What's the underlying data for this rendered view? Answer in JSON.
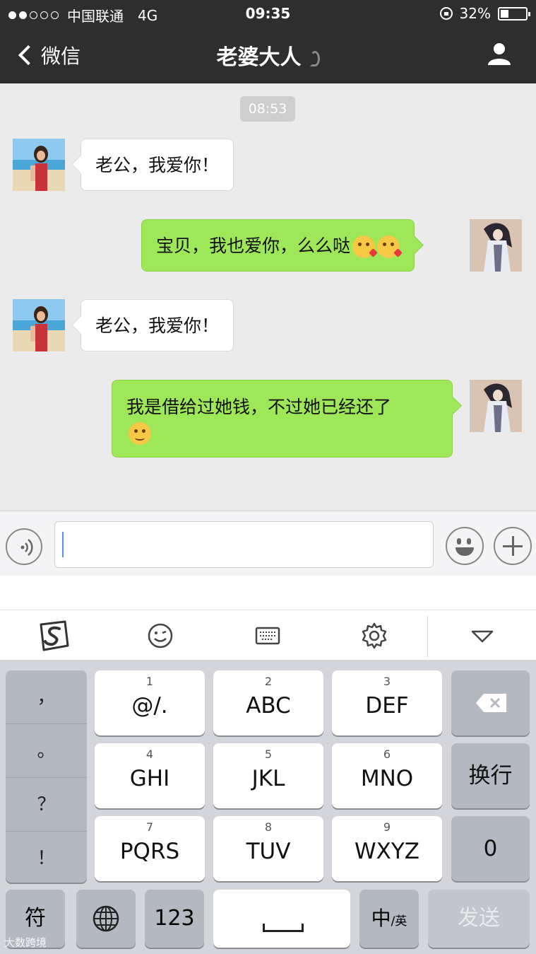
{
  "status_bar": {
    "carrier": "中国联通",
    "network": "4G",
    "time": "09:35",
    "battery_percent_text": "32%",
    "battery_level": 0.32,
    "signal_dots_filled": 2,
    "signal_dots_total": 5
  },
  "nav": {
    "back_label": "微信",
    "title": "老婆大人"
  },
  "chat": {
    "timestamp": "08:53",
    "messages": [
      {
        "side": "left",
        "text": "老公，我爱你！"
      },
      {
        "side": "right",
        "text": "宝贝，我也爱你，么么哒",
        "emojis": [
          "kiss-emoji",
          "kiss-emoji"
        ]
      },
      {
        "side": "left",
        "text": "老公，我爱你！"
      },
      {
        "side": "right",
        "text_line1": "我是借给过她钱，不过她已经还了",
        "emojis": [
          "blush-emoji"
        ]
      }
    ]
  },
  "input": {
    "value": "",
    "placeholder": ""
  },
  "ime_toolbar": {
    "items": [
      "sogou-logo-icon",
      "emoji-icon",
      "keyboard-icon",
      "settings-icon",
      "collapse-icon"
    ]
  },
  "keyboard": {
    "punctuation": [
      "，",
      "。",
      "？",
      "！"
    ],
    "keys": [
      {
        "num": "1",
        "label": "@/."
      },
      {
        "num": "2",
        "label": "ABC"
      },
      {
        "num": "3",
        "label": "DEF"
      },
      {
        "num": "4",
        "label": "GHI"
      },
      {
        "num": "5",
        "label": "JKL"
      },
      {
        "num": "6",
        "label": "MNO"
      },
      {
        "num": "7",
        "label": "PQRS"
      },
      {
        "num": "8",
        "label": "TUV"
      },
      {
        "num": "9",
        "label": "WXYZ"
      }
    ],
    "newline_label": "换行",
    "zero_label": "0",
    "symbol_label": "符",
    "numbers_label": "123",
    "lang_main": "中",
    "lang_sub": "/英",
    "send_label": "发送"
  },
  "watermark": "大数跨境",
  "colors": {
    "bar_background": "#2e2e2e",
    "chat_background": "#ebebeb",
    "sent_bubble": "#9ee758",
    "received_bubble": "#ffffff",
    "keyboard_background": "#d3d5db"
  }
}
